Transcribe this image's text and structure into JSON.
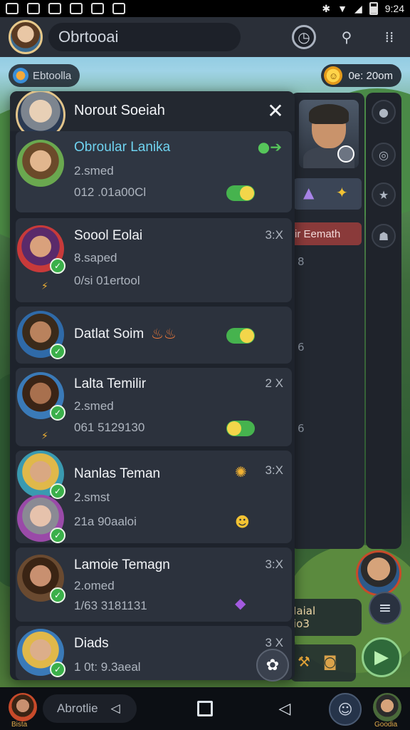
{
  "status_bar": {
    "time": "9:24"
  },
  "top_bar": {
    "search_text": "Obrtooai"
  },
  "hud": {
    "left_label": "Ebtoolla",
    "right_timer": "0e: 20om"
  },
  "overlay": {
    "title": "Norout Soeiah",
    "rows": [
      {
        "name": "Obroular Lanika",
        "sub1": "2.smed",
        "sub2": "012 .01a00Cl",
        "meta": "",
        "highlight": true
      },
      {
        "name": "Soool Eolai",
        "sub1": "8.saped",
        "sub2": "0/si 01ertool",
        "meta": "3:X"
      },
      {
        "name": "Datlat Soim",
        "sub1": "",
        "sub2": "",
        "meta": ""
      },
      {
        "name": "Lalta Temilir",
        "sub1": "2.smed",
        "sub2": "061 5129130",
        "meta": "2 X"
      },
      {
        "name": "Nanlas Teman",
        "sub1": "2.smst",
        "sub2": "21a 90aaloi",
        "meta": "3:X"
      },
      {
        "name": "Lamoie Temagn",
        "sub1": "2.omed",
        "sub2": "1/63 3181131",
        "meta": "3:X"
      },
      {
        "name": "Diads",
        "sub1": "1 0t: 9.3aeal",
        "sub2": "",
        "meta": "3 X"
      }
    ]
  },
  "side_panel": {
    "tab_label": "ir Eemath",
    "nums": [
      "8",
      "6",
      "6"
    ]
  },
  "br_hud": {
    "line1": "Iaial",
    "line2": "io3"
  },
  "nav": {
    "pill_label": "Abrotlie",
    "left_label": "Bista",
    "right_label": "Goodia"
  },
  "colors": {
    "accent_cyan": "#6fd3f0",
    "toggle_green": "#46b34e",
    "panel_bg": "#1e232c"
  }
}
